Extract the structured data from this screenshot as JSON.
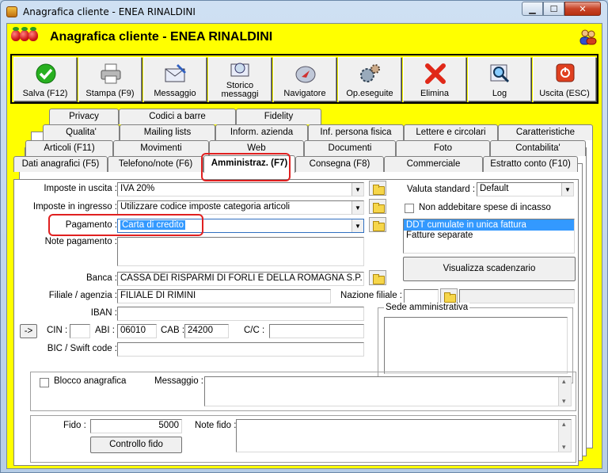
{
  "window": {
    "title": "Anagrafica cliente - ENEA RINALDINI"
  },
  "header": {
    "title": "Anagrafica cliente - ENEA RINALDINI"
  },
  "toolbar": [
    {
      "label": "Salva (F12)",
      "icon": "check-icon"
    },
    {
      "label": "Stampa (F9)",
      "icon": "printer-icon"
    },
    {
      "label": "Messaggio",
      "icon": "envelope-icon"
    },
    {
      "label": "Storico messaggi",
      "icon": "search-mail-icon"
    },
    {
      "label": "Navigatore",
      "icon": "compass-icon"
    },
    {
      "label": "Op.eseguite",
      "icon": "gears-icon"
    },
    {
      "label": "Elimina",
      "icon": "delete-x-icon"
    },
    {
      "label": "Log",
      "icon": "magnifier-icon"
    },
    {
      "label": "Uscita (ESC)",
      "icon": "exit-icon"
    }
  ],
  "tabs": {
    "row1": [
      "Privacy",
      "Codici a barre",
      "Fidelity"
    ],
    "row2": [
      "Qualita'",
      "Mailing lists",
      "Inform. azienda",
      "Inf. persona fisica",
      "Lettere e circolari",
      "Caratteristiche"
    ],
    "row3": [
      "Articoli (F11)",
      "Movimenti",
      "Web",
      "Documenti",
      "Foto",
      "Contabilita'"
    ],
    "row4": [
      "Dati anagrafici (F5)",
      "Telefono/note (F6)",
      "Amministraz. (F7)",
      "Consegna (F8)",
      "Commerciale",
      "Estratto conto (F10)"
    ]
  },
  "form": {
    "imposte_uscita_label": "Imposte in uscita :",
    "imposte_uscita": "IVA 20%",
    "imposte_ingresso_label": "Imposte in ingresso :",
    "imposte_ingresso": "Utilizzare codice imposte categoria articoli",
    "pagamento_label": "Pagamento :",
    "pagamento": "Carta di credito",
    "note_pagamento_label": "Note pagamento :",
    "banca_label": "Banca :",
    "banca": "CASSA DEI RISPARMI DI FORLI E DELLA ROMAGNA S.P.",
    "filiale_label": "Filiale / agenzia :",
    "filiale": "FILIALE DI RIMINI",
    "nazione_label": "Nazione filiale :",
    "iban_label": "IBAN :",
    "arrow_btn": "->",
    "cin_label": "CIN :",
    "abi_label": "ABI :",
    "abi": "06010",
    "cab_label": "CAB :",
    "cab": "24200",
    "cc_label": "C/C :",
    "bic_label": "BIC / Swift code :",
    "valuta_label": "Valuta standard :",
    "valuta": "Default",
    "non_addebitare": "Non addebitare spese di incasso",
    "list": [
      "DDT cumulate in unica fattura",
      "Fatture separate"
    ],
    "visualizza": "Visualizza scadenzario",
    "sede_label": "Sede amministrativa",
    "blocco": "Blocco anagrafica",
    "messaggio_label": "Messaggio :",
    "fido_label": "Fido :",
    "fido": "5000",
    "note_fido_label": "Note fido :",
    "controllo_fido": "Controllo fido"
  }
}
